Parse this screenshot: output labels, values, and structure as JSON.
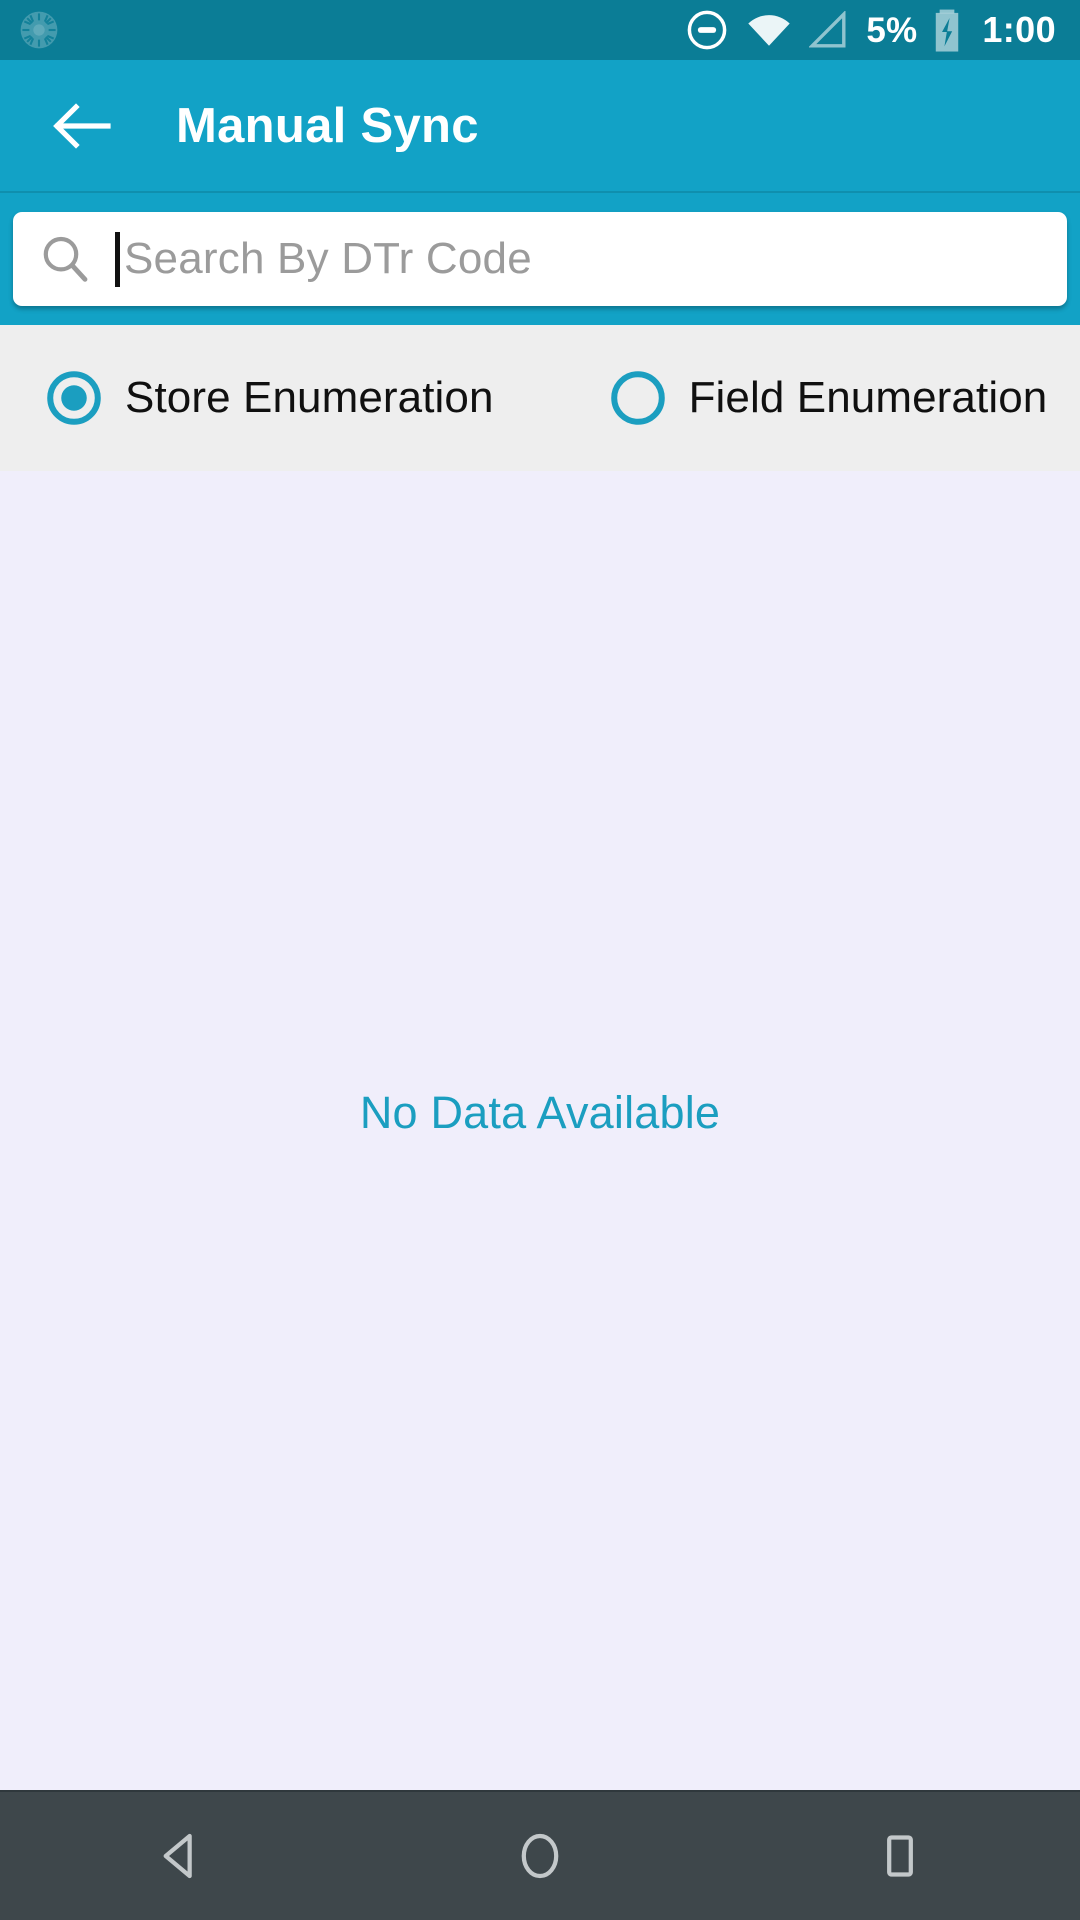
{
  "status_bar": {
    "background": "#0b7d96",
    "left_icon": "sync-spinner-icon",
    "icons": [
      "do-not-disturb-icon",
      "wifi-icon",
      "cell-signal-icon",
      "battery-charging-icon"
    ],
    "battery_percent": "5%",
    "clock": "1:00"
  },
  "appbar": {
    "background": "#12a2c6",
    "back_icon": "back-arrow-icon",
    "title": "Manual Sync"
  },
  "search": {
    "icon": "search-icon",
    "value": "",
    "placeholder": "Search By DTr Code",
    "cursor_visible": true
  },
  "radio_group": {
    "background": "#eeeeee",
    "accent": "#1b9ec0",
    "selected": "Store Enumeration",
    "options": [
      {
        "label": "Store Enumeration",
        "selected": true
      },
      {
        "label": "Field Enumeration",
        "selected": false
      }
    ]
  },
  "content": {
    "background": "#f0eefb",
    "empty_message": "No Data Available",
    "empty_message_color": "#1b9ec0"
  },
  "navbar": {
    "background": "#3e474b",
    "buttons": [
      "back-nav-icon",
      "home-nav-icon",
      "recents-nav-icon"
    ]
  }
}
